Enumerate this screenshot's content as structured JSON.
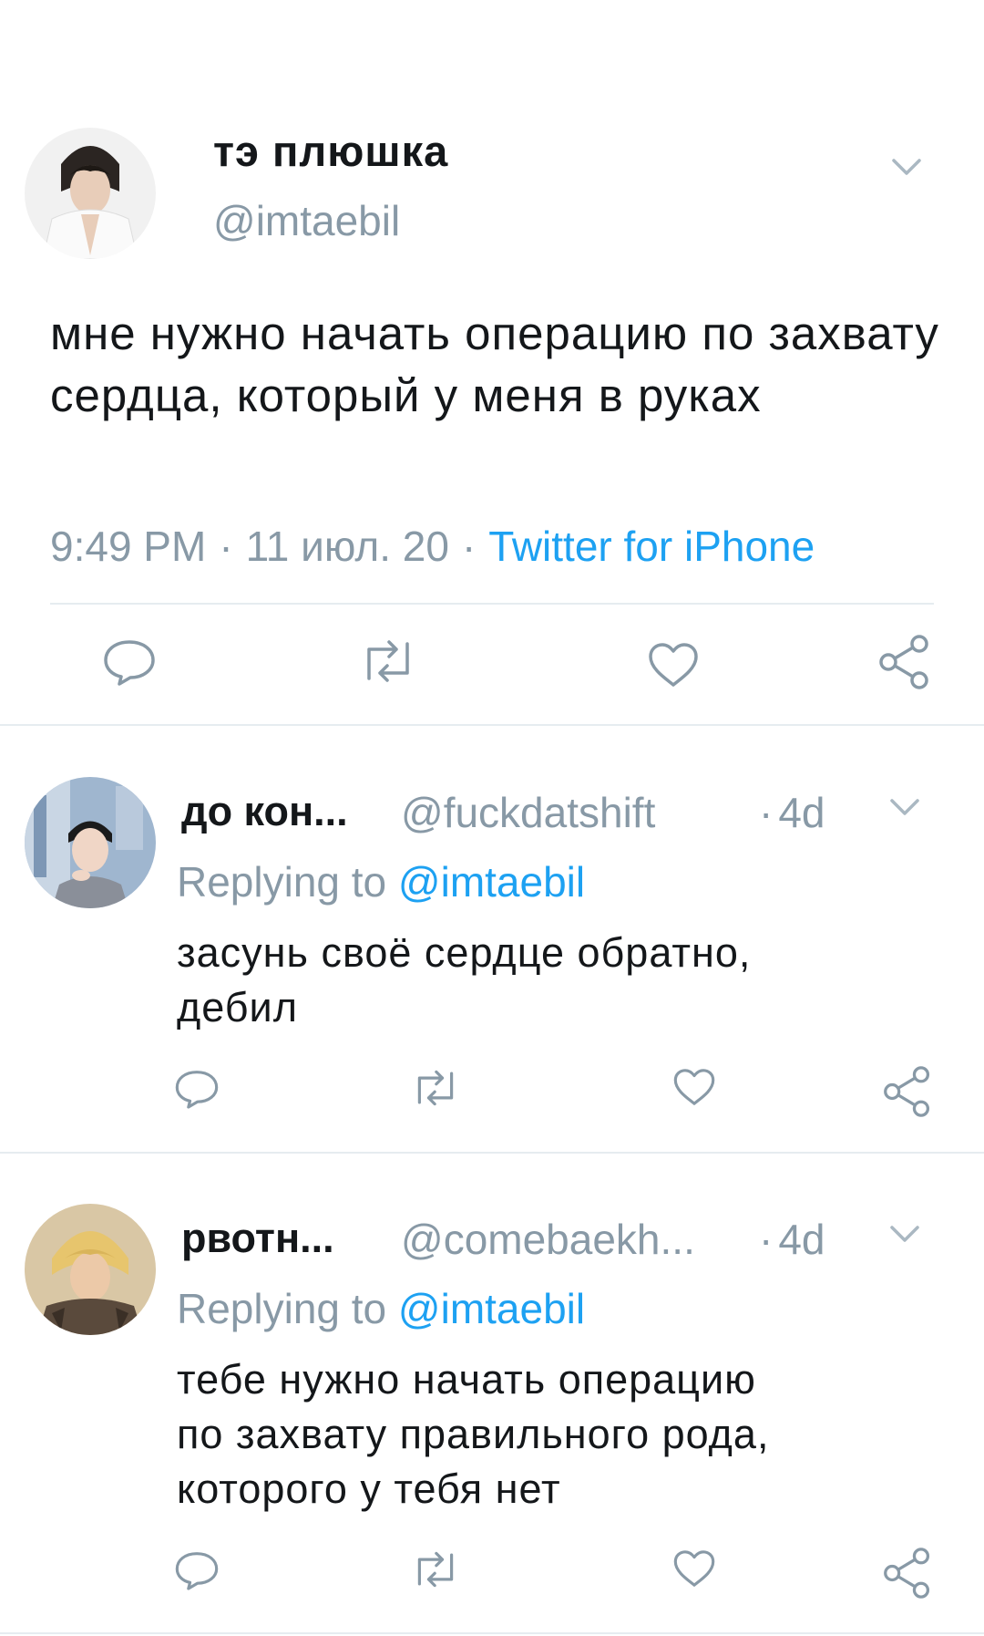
{
  "main_tweet": {
    "name": "тэ плюшка",
    "handle": "@imtaebil",
    "text": "мне нужно начать операцию по захвату сердца, который у меня в руках",
    "time": "9:49 PM",
    "date": "11 июл. 20",
    "source": "Twitter for iPhone",
    "separator": "·",
    "avatar_icon": "avatar-photo",
    "action_icons": [
      "reply-icon",
      "retweet-icon",
      "like-icon",
      "share-icon"
    ]
  },
  "replies": [
    {
      "name": "до кон...",
      "handle": "@fuckdatshift",
      "time": "4d",
      "time_separator": "·",
      "replying_prefix": "Replying to ",
      "replying_mention": "@imtaebil",
      "text_lines": [
        "засунь своё сердце обратно,",
        "дебил"
      ]
    },
    {
      "name": "рвотн...",
      "handle": "@comebaekh...",
      "time": "4d",
      "time_separator": "·",
      "replying_prefix": "Replying to ",
      "replying_mention": "@imtaebil",
      "text_lines": [
        "тебе нужно начать операцию",
        "по захвату правильного рода,",
        "которого у тебя нет"
      ]
    }
  ],
  "colors": {
    "text": "#14171a",
    "secondary": "#8899a6",
    "link": "#1da1f2",
    "divider": "#e6ecf0"
  }
}
